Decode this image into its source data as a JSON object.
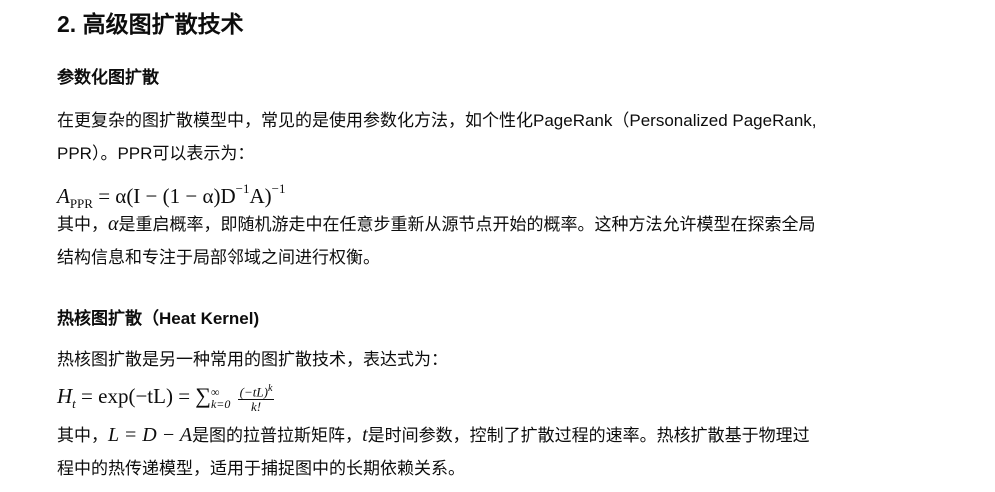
{
  "section": {
    "title": "2. 高级图扩散技术"
  },
  "ppr": {
    "heading": "参数化图扩散",
    "intro_line1": "在更复杂的图扩散模型中，常见的是使用参数化方法，如个性化PageRank（Personalized PageRank,",
    "intro_line2": "PPR）。PPR可以表示为：",
    "formula": {
      "lhs": "A",
      "lhs_sub": "PPR",
      "rhs_main": "= α(I − (1 − α)D",
      "rhs_sup1": "−1",
      "rhs_tail": "A)",
      "rhs_sup2": "−1"
    },
    "explain_prefix": "其中，",
    "alpha_symbol": "α",
    "explain_line1_rest": "是重启概率，即随机游走中在任意步重新从源节点开始的概率。这种方法允许模型在探索全局",
    "explain_line2": "结构信息和专注于局部邻域之间进行权衡。"
  },
  "heat": {
    "heading": "热核图扩散（Heat Kernel)",
    "intro": "热核图扩散是另一种常用的图扩散技术，表达式为：",
    "formula": {
      "lhs": "H",
      "lhs_sub": "t",
      "eq_exp": "= exp(−tL) =",
      "sum": "∑",
      "sum_upper": "∞",
      "sum_lower": "k=0",
      "frac_num": "(−tL)",
      "frac_num_sup": "k",
      "frac_den": "k!"
    },
    "explain_prefix": "其中，",
    "laplacian_expr": "L = D − A",
    "explain_mid": "是图的拉普拉斯矩阵，",
    "t_symbol": "t",
    "explain_line1_rest": "是时间参数，控制了扩散过程的速率。热核扩散基于物理过",
    "explain_line2": "程中的热传递模型，适用于捕捉图中的长期依赖关系。"
  }
}
